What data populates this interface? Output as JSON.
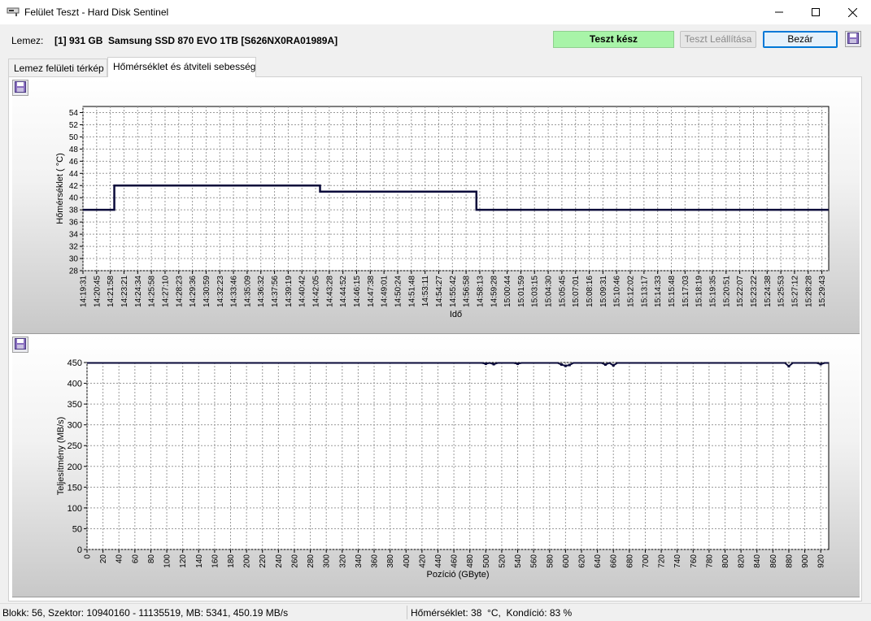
{
  "window": {
    "title": "Felület Teszt - Hard Disk Sentinel",
    "minimize_icon": "minimize-icon",
    "maximize_icon": "maximize-icon",
    "close_icon": "close-icon"
  },
  "toolbar": {
    "disk_label": "Lemez:",
    "disk_value": "[1] 931 GB  Samsung SSD 870 EVO 1TB [S626NX0RA01989A]",
    "status": "Teszt kész",
    "stop_button": "Teszt Leállítása",
    "close_button": "Bezár",
    "status_color": "#a8f4a8"
  },
  "tabs": [
    {
      "label": "Lemez felületi térkép",
      "active": false
    },
    {
      "label": "Hőmérséklet és átviteli sebesség",
      "active": true
    }
  ],
  "status_bar": {
    "left": "Blokk: 56, Szektor: 10940160 - 11135519, MB: 5341, 450.19 MB/s",
    "right": "Hőmérséklet: 38  °C,  Kondíció: 83 %"
  },
  "chart_data": [
    {
      "type": "line",
      "xlabel": "Idő",
      "ylabel": "Hőmérséklet ( °C)",
      "ylim": [
        28,
        55
      ],
      "yticks": [
        28,
        30,
        32,
        34,
        36,
        38,
        40,
        42,
        44,
        46,
        48,
        50,
        52,
        54
      ],
      "x_tick_labels": [
        "14:19:31",
        "14:20:45",
        "14:21:58",
        "14:23:21",
        "14:24:34",
        "14:25:58",
        "14:27:10",
        "14:28:23",
        "14:29:36",
        "14:30:59",
        "14:32:23",
        "14:33:46",
        "14:35:09",
        "14:36:32",
        "14:37:56",
        "14:39:19",
        "14:40:42",
        "14:42:05",
        "14:43:28",
        "14:44:52",
        "14:46:15",
        "14:47:38",
        "14:49:01",
        "14:50:24",
        "14:51:48",
        "14:53:11",
        "14:54:27",
        "14:55:42",
        "14:56:58",
        "14:58:13",
        "14:59:28",
        "15:00:44",
        "15:01:59",
        "15:03:15",
        "15:04:30",
        "15:05:45",
        "15:07:01",
        "15:08:16",
        "15:09:31",
        "15:10:46",
        "15:12:02",
        "15:13:17",
        "15:14:33",
        "15:15:48",
        "15:17:03",
        "15:18:19",
        "15:19:35",
        "15:20:51",
        "15:22:07",
        "15:23:22",
        "15:24:38",
        "15:25:53",
        "15:27:12",
        "15:28:28",
        "15:29:43"
      ],
      "steps": [
        {
          "from": "14:19:31",
          "to": "14:22:30",
          "value": 38
        },
        {
          "from": "14:22:30",
          "to": "14:42:05",
          "value": 42
        },
        {
          "from": "14:42:05",
          "to": "14:56:58",
          "value": 41
        },
        {
          "from": "14:56:58",
          "to": "15:30:30",
          "value": 38
        }
      ],
      "line_color": "#0a0a3a",
      "grid": true
    },
    {
      "type": "scatter",
      "xlabel": "Pozíció (GByte)",
      "ylabel": "Teljesítmény (MB/s)",
      "ylim": [
        0,
        450
      ],
      "xlim": [
        0,
        930
      ],
      "yticks": [
        0,
        50,
        100,
        150,
        200,
        250,
        300,
        350,
        400,
        450
      ],
      "xticks": [
        0,
        20,
        40,
        60,
        80,
        100,
        120,
        140,
        160,
        180,
        200,
        220,
        240,
        260,
        280,
        300,
        320,
        340,
        360,
        380,
        400,
        420,
        440,
        460,
        480,
        500,
        520,
        540,
        560,
        580,
        600,
        620,
        640,
        660,
        680,
        700,
        720,
        740,
        760,
        780,
        800,
        820,
        840,
        860,
        880,
        900,
        920
      ],
      "baseline_value": 450,
      "dips": [
        {
          "x": 500,
          "y": 447
        },
        {
          "x": 510,
          "y": 446
        },
        {
          "x": 540,
          "y": 447
        },
        {
          "x": 595,
          "y": 445
        },
        {
          "x": 600,
          "y": 442
        },
        {
          "x": 605,
          "y": 444
        },
        {
          "x": 650,
          "y": 445
        },
        {
          "x": 660,
          "y": 443
        },
        {
          "x": 880,
          "y": 441
        },
        {
          "x": 920,
          "y": 446
        }
      ],
      "point_color": "#0a0a3a",
      "grid": true
    }
  ]
}
